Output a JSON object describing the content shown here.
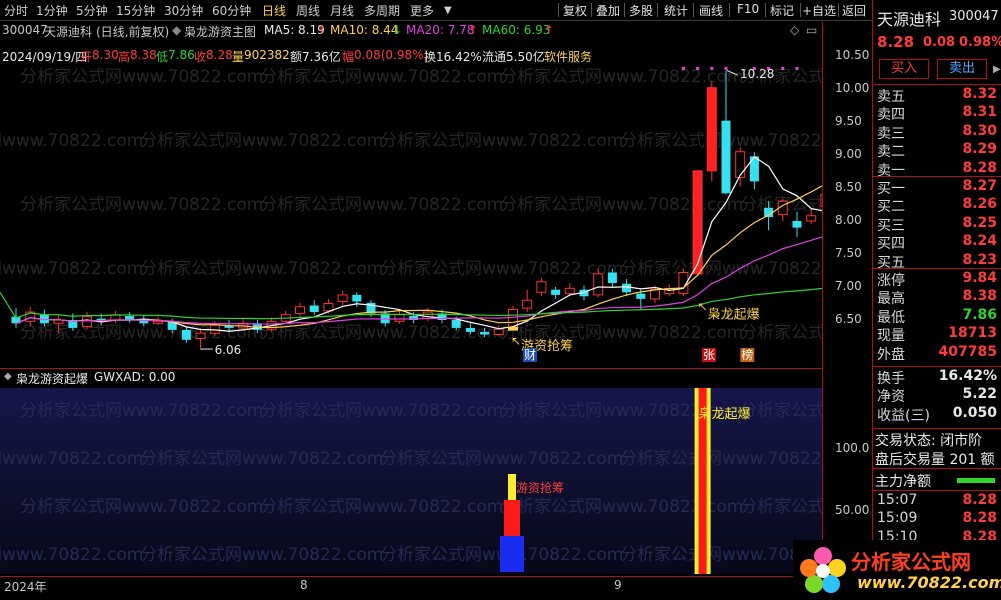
{
  "toolbar": {
    "periods": [
      "分时",
      "1分钟",
      "5分钟",
      "15分钟",
      "30分钟",
      "60分钟",
      "日线",
      "周线",
      "月线",
      "多周期",
      "更多"
    ],
    "active_period": "日线",
    "tools": [
      "复权",
      "叠加",
      "多股",
      "统计",
      "画线",
      "F10",
      "标记",
      "+自选",
      "返回"
    ]
  },
  "chart_header": {
    "code": "300047",
    "name": "天源迪科",
    "mode": "(日线,前复权)",
    "formula": "枭龙游资主图",
    "ma5": "MA5: 8.19",
    "ma10": "MA10: 8.44",
    "ma20": "MA20: 7.78",
    "ma60": "MA60: 6.93",
    "arrow_up": "↑",
    "arrow_down": "↓"
  },
  "data_line": {
    "date": "2024/09/19/四",
    "open_label": "开",
    "open": "8.30",
    "high_label": "高",
    "high": "8.38",
    "low_label": "低",
    "low": "7.86",
    "close_label": "收",
    "close": "8.28",
    "vol_label": "量",
    "vol": "902382",
    "amount_label": "额",
    "amount": "7.36亿",
    "chg_label": "幅",
    "chg": "0.08(0.98%)",
    "turnover": "换16.42%",
    "float": "流通5.50亿",
    "sector": "软件服务"
  },
  "main_axis": [
    "10.50",
    "10.00",
    "9.50",
    "9.00",
    "8.50",
    "8.00",
    "7.50",
    "7.00",
    "6.50"
  ],
  "annotations": {
    "high_mark": "10.28",
    "low_mark": "6.06",
    "signal1": "游资抢筹",
    "signal2": "枭龙起爆",
    "tag_cai": "财",
    "tag_zhang": "张",
    "tag_bang": "榜",
    "watermark": "分析家公式网www.70822.com"
  },
  "sub_header": {
    "name": "枭龙游资起爆",
    "value": "GWXAD: 0.00"
  },
  "sub_axis": [
    "100.0",
    "50.00"
  ],
  "sub_labels": {
    "signal1": "游资抢筹",
    "signal2": "枭龙起爆"
  },
  "date_axis": [
    "2024年",
    "8",
    "9"
  ],
  "right_panel": {
    "name": "天源迪科",
    "code": "300047",
    "price": "8.28",
    "change": "0.08",
    "pct": "0.98%",
    "buy_btn": "买入",
    "sell_btn": "卖出",
    "asks": [
      {
        "label": "卖五",
        "price": "8.32"
      },
      {
        "label": "卖四",
        "price": "8.31"
      },
      {
        "label": "卖三",
        "price": "8.30"
      },
      {
        "label": "卖二",
        "price": "8.29"
      },
      {
        "label": "卖一",
        "price": "8.28"
      }
    ],
    "bids": [
      {
        "label": "买一",
        "price": "8.27"
      },
      {
        "label": "买二",
        "price": "8.26"
      },
      {
        "label": "买三",
        "price": "8.25"
      },
      {
        "label": "买四",
        "price": "8.24"
      },
      {
        "label": "买五",
        "price": "8.23"
      }
    ],
    "stats": [
      {
        "label": "涨停",
        "value": "9.84"
      },
      {
        "label": "最高",
        "value": "8.38"
      },
      {
        "label": "最低",
        "value": "7.86"
      },
      {
        "label": "现量",
        "value": "18713"
      },
      {
        "label": "外盘",
        "value": "407785"
      }
    ],
    "stats2": [
      {
        "label": "换手",
        "value": "16.42%"
      },
      {
        "label": "净资",
        "value": "5.22"
      },
      {
        "label": "收益(三)",
        "value": "0.050"
      }
    ],
    "trade_status": "交易状态: 闭市阶",
    "after_hours": "盘后交易量 201 额",
    "main_net": "主力净额",
    "ticks": [
      {
        "time": "15:07",
        "price": "8.28"
      },
      {
        "time": "15:09",
        "price": "8.28"
      },
      {
        "time": "15:10",
        "price": "8.28"
      }
    ]
  },
  "logo": {
    "title": "分析家公式网",
    "url": "www.70822.com"
  },
  "chart_data": {
    "type": "candlestick",
    "ylim": [
      5.9,
      10.6
    ],
    "candles": [
      {
        "o": 6.55,
        "c": 6.45,
        "h": 6.68,
        "l": 6.38
      },
      {
        "o": 6.48,
        "c": 6.62,
        "h": 6.7,
        "l": 6.4
      },
      {
        "o": 6.58,
        "c": 6.45,
        "h": 6.66,
        "l": 6.4
      },
      {
        "o": 6.45,
        "c": 6.5,
        "h": 6.58,
        "l": 6.3
      },
      {
        "o": 6.5,
        "c": 6.38,
        "h": 6.6,
        "l": 6.34
      },
      {
        "o": 6.4,
        "c": 6.55,
        "h": 6.62,
        "l": 6.36
      },
      {
        "o": 6.52,
        "c": 6.48,
        "h": 6.6,
        "l": 6.42
      },
      {
        "o": 6.5,
        "c": 6.58,
        "h": 6.64,
        "l": 6.45
      },
      {
        "o": 6.56,
        "c": 6.5,
        "h": 6.62,
        "l": 6.46
      },
      {
        "o": 6.52,
        "c": 6.45,
        "h": 6.58,
        "l": 6.4
      },
      {
        "o": 6.45,
        "c": 6.48,
        "h": 6.55,
        "l": 6.42
      },
      {
        "o": 6.48,
        "c": 6.35,
        "h": 6.52,
        "l": 6.3
      },
      {
        "o": 6.35,
        "c": 6.2,
        "h": 6.4,
        "l": 6.15
      },
      {
        "o": 6.22,
        "c": 6.3,
        "h": 6.38,
        "l": 6.06
      },
      {
        "o": 6.3,
        "c": 6.42,
        "h": 6.48,
        "l": 6.26
      },
      {
        "o": 6.42,
        "c": 6.38,
        "h": 6.5,
        "l": 6.32
      },
      {
        "o": 6.38,
        "c": 6.45,
        "h": 6.52,
        "l": 6.34
      },
      {
        "o": 6.45,
        "c": 6.35,
        "h": 6.5,
        "l": 6.3
      },
      {
        "o": 6.36,
        "c": 6.48,
        "h": 6.54,
        "l": 6.32
      },
      {
        "o": 6.48,
        "c": 6.58,
        "h": 6.64,
        "l": 6.44
      },
      {
        "o": 6.6,
        "c": 6.7,
        "h": 6.76,
        "l": 6.55
      },
      {
        "o": 6.72,
        "c": 6.62,
        "h": 6.8,
        "l": 6.58
      },
      {
        "o": 6.64,
        "c": 6.75,
        "h": 6.82,
        "l": 6.6
      },
      {
        "o": 6.78,
        "c": 6.88,
        "h": 6.94,
        "l": 6.72
      },
      {
        "o": 6.88,
        "c": 6.78,
        "h": 6.92,
        "l": 6.7
      },
      {
        "o": 6.76,
        "c": 6.6,
        "h": 6.8,
        "l": 6.55
      },
      {
        "o": 6.6,
        "c": 6.45,
        "h": 6.65,
        "l": 6.4
      },
      {
        "o": 6.48,
        "c": 6.58,
        "h": 6.65,
        "l": 6.44
      },
      {
        "o": 6.56,
        "c": 6.5,
        "h": 6.62,
        "l": 6.45
      },
      {
        "o": 6.52,
        "c": 6.62,
        "h": 6.68,
        "l": 6.48
      },
      {
        "o": 6.6,
        "c": 6.5,
        "h": 6.66,
        "l": 6.45
      },
      {
        "o": 6.5,
        "c": 6.38,
        "h": 6.55,
        "l": 6.34
      },
      {
        "o": 6.38,
        "c": 6.32,
        "h": 6.45,
        "l": 6.28
      },
      {
        "o": 6.32,
        "c": 6.28,
        "h": 6.38,
        "l": 6.24
      },
      {
        "o": 6.28,
        "c": 6.36,
        "h": 6.42,
        "l": 6.25
      },
      {
        "o": 6.38,
        "c": 6.66,
        "h": 6.72,
        "l": 6.36
      },
      {
        "o": 6.68,
        "c": 6.8,
        "h": 6.96,
        "l": 6.62
      },
      {
        "o": 6.92,
        "c": 7.08,
        "h": 7.14,
        "l": 6.86
      },
      {
        "o": 6.96,
        "c": 6.88,
        "h": 7.0,
        "l": 6.82
      },
      {
        "o": 6.9,
        "c": 6.98,
        "h": 7.06,
        "l": 6.86
      },
      {
        "o": 6.96,
        "c": 6.86,
        "h": 7.02,
        "l": 6.8
      },
      {
        "o": 6.88,
        "c": 7.2,
        "h": 7.28,
        "l": 6.84
      },
      {
        "o": 7.22,
        "c": 7.06,
        "h": 7.28,
        "l": 7.0
      },
      {
        "o": 7.05,
        "c": 6.92,
        "h": 7.12,
        "l": 6.86
      },
      {
        "o": 6.9,
        "c": 6.82,
        "h": 6.96,
        "l": 6.65
      },
      {
        "o": 6.82,
        "c": 6.96,
        "h": 7.02,
        "l": 6.76
      },
      {
        "o": 6.9,
        "c": 6.98,
        "h": 7.04,
        "l": 6.86
      },
      {
        "o": 6.9,
        "c": 7.22,
        "h": 7.28,
        "l": 6.86
      },
      {
        "o": 7.2,
        "c": 8.76,
        "h": 8.76,
        "l": 7.18
      },
      {
        "o": 8.76,
        "c": 10.02,
        "h": 10.12,
        "l": 8.6
      },
      {
        "o": 9.52,
        "c": 8.42,
        "h": 10.28,
        "l": 8.4
      },
      {
        "o": 8.66,
        "c": 9.05,
        "h": 9.12,
        "l": 8.52
      },
      {
        "o": 8.98,
        "c": 8.6,
        "h": 9.04,
        "l": 8.48
      },
      {
        "o": 8.2,
        "c": 8.06,
        "h": 8.3,
        "l": 7.86
      },
      {
        "o": 8.1,
        "c": 8.3,
        "h": 8.34,
        "l": 8.0
      },
      {
        "o": 8.0,
        "c": 7.9,
        "h": 8.14,
        "l": 7.76
      },
      {
        "o": 8.0,
        "c": 8.08,
        "h": 8.2,
        "l": 7.96
      },
      {
        "o": 8.22,
        "c": 8.4,
        "h": 8.88,
        "l": 8.08
      },
      {
        "o": 8.36,
        "c": 8.14,
        "h": 8.58,
        "l": 8.1
      },
      {
        "o": 8.12,
        "c": 8.22,
        "h": 8.72,
        "l": 8.06
      },
      {
        "o": 8.3,
        "c": 8.28,
        "h": 8.38,
        "l": 7.86
      }
    ],
    "sub_bars": [
      {
        "index": 35,
        "type": "signal1"
      },
      {
        "index": 48,
        "type": "signal2"
      }
    ]
  }
}
